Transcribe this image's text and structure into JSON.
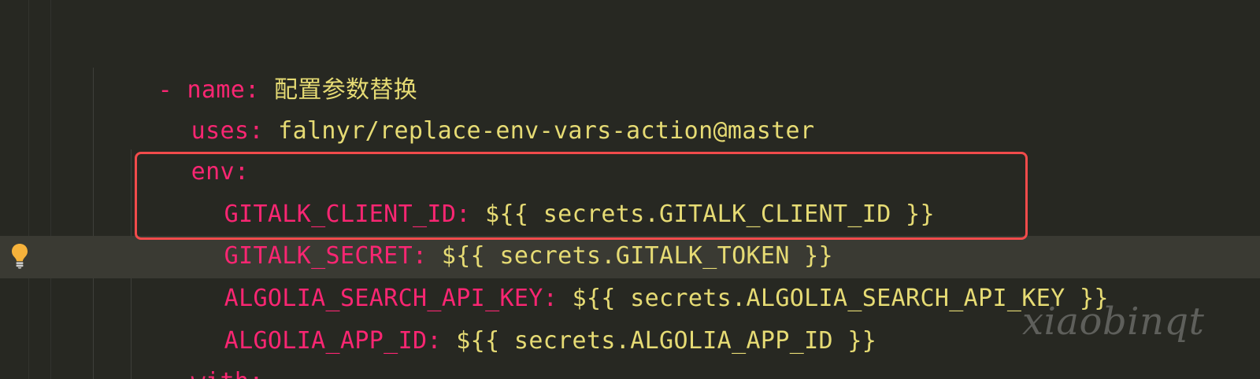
{
  "editor": {
    "lines": [
      {
        "dash": "-",
        "key": "name",
        "colon": ":",
        "value": "配置参数替换"
      },
      {
        "key": "uses",
        "colon": ":",
        "value": "falnyr/replace-env-vars-action@master"
      },
      {
        "key": "env",
        "colon": ":"
      },
      {
        "key": "GITALK_CLIENT_ID",
        "colon": ":",
        "value": "${{ secrets.GITALK_CLIENT_ID }}"
      },
      {
        "key": "GITALK_SECRET",
        "colon": ":",
        "value": "${{ secrets.GITALK_TOKEN }}"
      },
      {
        "key": "ALGOLIA_SEARCH_API_KEY",
        "colon": ":",
        "value": "${{ secrets.ALGOLIA_SEARCH_API_KEY }}"
      },
      {
        "key": "ALGOLIA_APP_ID",
        "colon": ":",
        "value": "${{ secrets.ALGOLIA_APP_ID }}"
      },
      {
        "key": "with",
        "colon": ":"
      }
    ],
    "watermark": "xiaobinqt",
    "icons": {
      "lightbulb": "lightbulb-icon"
    },
    "colors": {
      "background": "#272822",
      "key": "#f92672",
      "value": "#e6db74",
      "highlight": "#f24b4b",
      "lightbulb": "#f6b23b"
    }
  }
}
